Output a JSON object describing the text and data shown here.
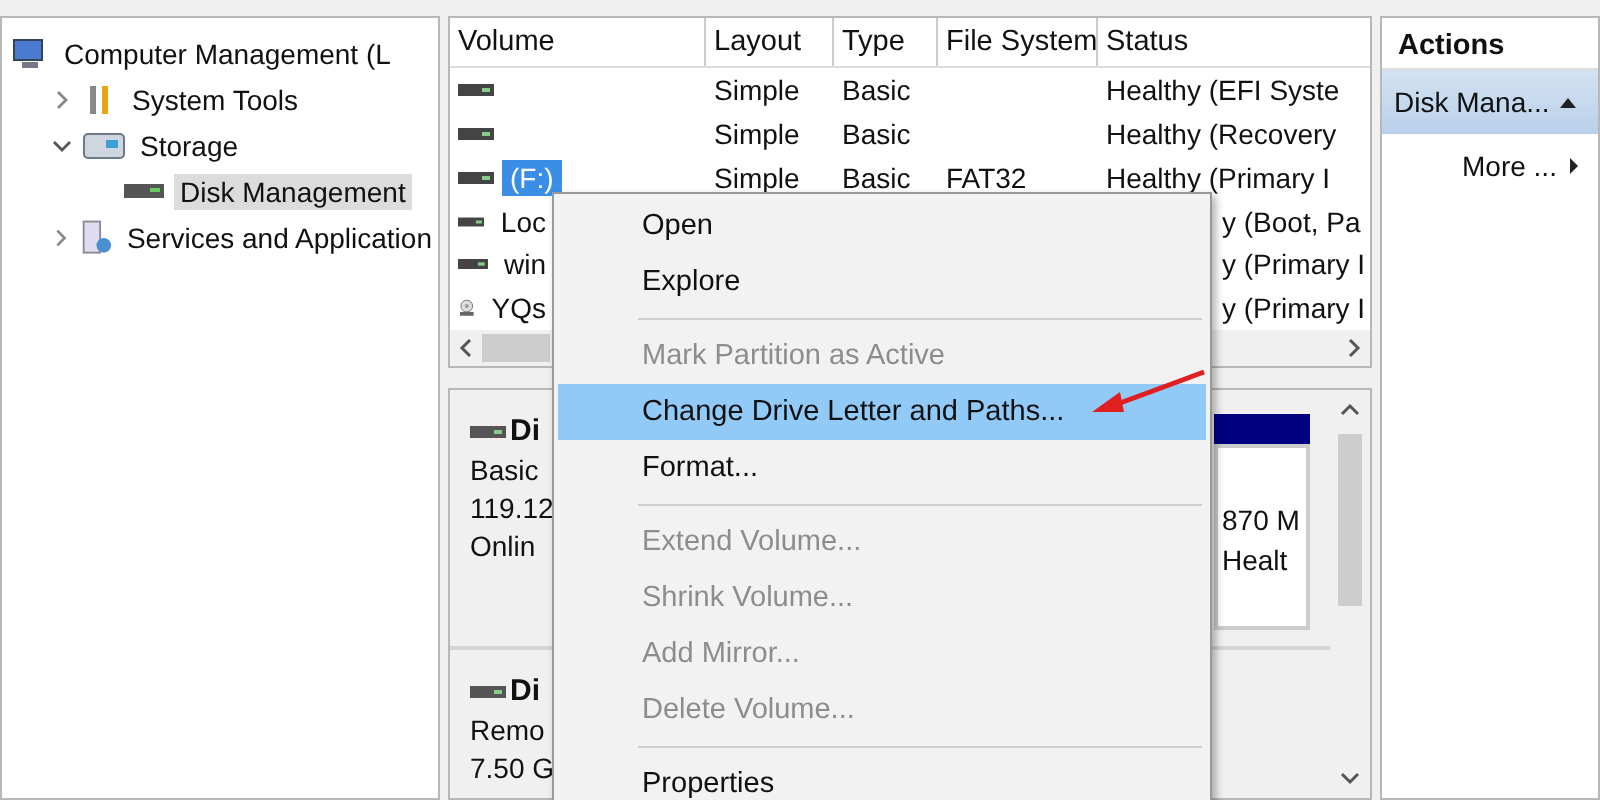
{
  "tree": [
    {
      "label": "Computer Management (L",
      "selected": false,
      "children": [
        {
          "label": "System Tools",
          "expanded": false,
          "selected": false
        },
        {
          "label": "Storage",
          "expanded": true,
          "selected": false,
          "children": [
            {
              "label": "Disk Management",
              "selected": true
            }
          ]
        },
        {
          "label": "Services and Application",
          "expanded": false,
          "selected": false
        }
      ]
    }
  ],
  "volumes": {
    "columns": [
      "Volume",
      "Layout",
      "Type",
      "File System",
      "Status"
    ],
    "rows": [
      {
        "kind": "full",
        "selected": false,
        "cells": [
          "",
          "Simple",
          "Basic",
          "",
          "Healthy (EFI Syste"
        ]
      },
      {
        "kind": "full",
        "selected": false,
        "cells": [
          "",
          "Simple",
          "Basic",
          "",
          "Healthy (Recovery"
        ]
      },
      {
        "kind": "full",
        "selected": true,
        "cells": [
          "(F:)",
          "Simple",
          "Basic",
          "FAT32",
          "Healthy (Primary I"
        ]
      },
      {
        "kind": "partial",
        "selected": false,
        "cells": [
          "Loc",
          "y (Boot, Pa"
        ]
      },
      {
        "kind": "partial",
        "selected": false,
        "cells": [
          "win",
          "y (Primary I"
        ]
      },
      {
        "kind": "partial",
        "selected": false,
        "cells": [
          "YQs",
          "y (Primary I"
        ]
      }
    ]
  },
  "disks": [
    {
      "name": "Di",
      "lines": [
        "Basic",
        "119.12",
        "Onlin"
      ],
      "partition": [
        "870 M",
        "Healt"
      ]
    },
    {
      "name": "Di",
      "lines": [
        "Remo",
        "7.50 G"
      ]
    }
  ],
  "context_menu": [
    {
      "kind": "item",
      "label": "Open",
      "disabled": false,
      "selected": false
    },
    {
      "kind": "item",
      "label": "Explore",
      "disabled": false,
      "selected": false
    },
    {
      "kind": "separator"
    },
    {
      "kind": "item",
      "label": "Mark Partition as Active",
      "disabled": true,
      "selected": false
    },
    {
      "kind": "item",
      "label": "Change Drive Letter and Paths...",
      "disabled": false,
      "selected": true
    },
    {
      "kind": "item",
      "label": "Format...",
      "disabled": false,
      "selected": false
    },
    {
      "kind": "separator"
    },
    {
      "kind": "item",
      "label": "Extend Volume...",
      "disabled": true,
      "selected": false
    },
    {
      "kind": "item",
      "label": "Shrink Volume...",
      "disabled": true,
      "selected": false
    },
    {
      "kind": "item",
      "label": "Add Mirror...",
      "disabled": true,
      "selected": false
    },
    {
      "kind": "item",
      "label": "Delete Volume...",
      "disabled": true,
      "selected": false
    },
    {
      "kind": "separator"
    },
    {
      "kind": "item",
      "label": "Properties",
      "disabled": false,
      "selected": false
    }
  ],
  "actions": {
    "title": "Actions",
    "items": [
      {
        "kind": "section",
        "label": "Disk Mana..."
      },
      {
        "kind": "link",
        "label": "More ..."
      }
    ]
  }
}
